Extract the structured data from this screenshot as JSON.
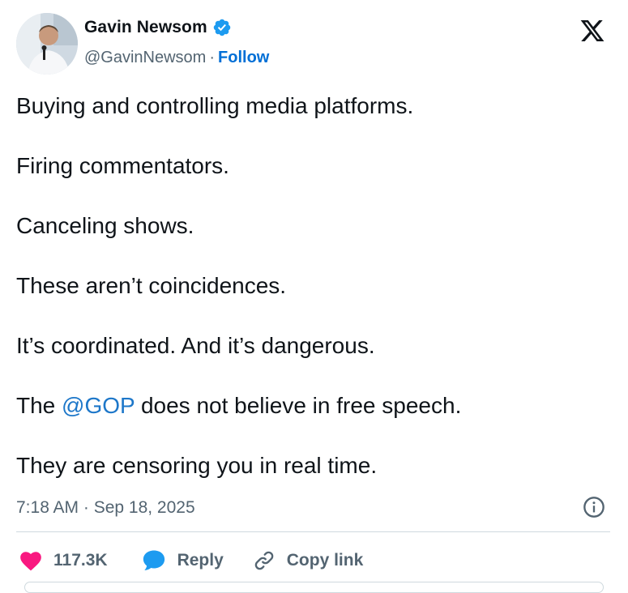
{
  "author": {
    "name": "Gavin Newsom",
    "handle": "@GavinNewsom",
    "separator": "·",
    "follow_label": "Follow",
    "verified": true
  },
  "tweet": {
    "lines": [
      {
        "text": "Buying and controlling media platforms."
      },
      {
        "text": "Firing commentators."
      },
      {
        "text": "Canceling shows."
      },
      {
        "text": "These aren’t coincidences."
      },
      {
        "text": "It’s coordinated. And it’s dangerous."
      },
      {
        "before": "The ",
        "mention": "@GOP",
        "after": " does not believe in free speech."
      },
      {
        "text": "They are censoring you in real time."
      }
    ],
    "timestamp": "7:18 AM · Sep 18, 2025"
  },
  "actions": {
    "likes_count": "117.3K",
    "reply_label": "Reply",
    "copy_link_label": "Copy link"
  },
  "icons": {
    "verified": "verified-badge-icon",
    "platform": "x-logo-icon",
    "info": "info-icon",
    "like": "heart-icon",
    "reply": "speech-bubble-icon",
    "copy": "link-icon"
  },
  "colors": {
    "link": "#006fd6",
    "mention": "#1d77c9",
    "verified": "#1d9bf0",
    "heart": "#f91880",
    "reply_icon": "#1d9bf0",
    "muted": "#536471"
  }
}
